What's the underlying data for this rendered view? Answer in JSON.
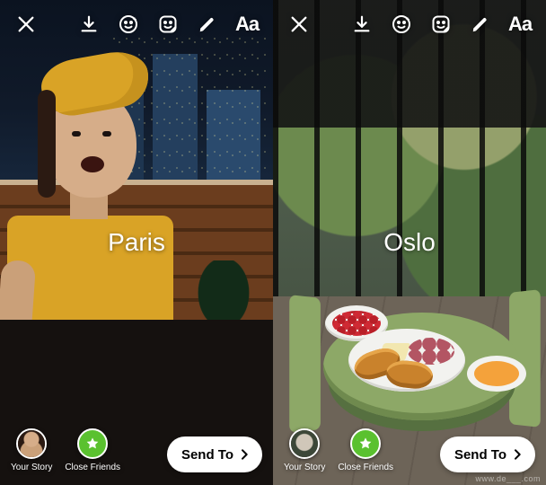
{
  "panels": [
    {
      "location_label": "Paris",
      "topbar": {
        "close": "close",
        "save": "save",
        "effects": "face-effects",
        "stickers": "stickers",
        "draw": "draw",
        "text_tool": "Aa"
      },
      "bottombar": {
        "your_story_label": "Your Story",
        "close_friends_label": "Close Friends",
        "send_to_label": "Send To"
      }
    },
    {
      "location_label": "Oslo",
      "topbar": {
        "close": "close",
        "save": "save",
        "effects": "face-effects",
        "stickers": "stickers",
        "draw": "draw",
        "text_tool": "Aa"
      },
      "bottombar": {
        "your_story_label": "Your Story",
        "close_friends_label": "Close Friends",
        "send_to_label": "Send To"
      },
      "watermark": "www.de___.com"
    }
  ],
  "colors": {
    "close_friends_badge": "#5ac12f",
    "send_pill_bg": "#ffffff"
  }
}
